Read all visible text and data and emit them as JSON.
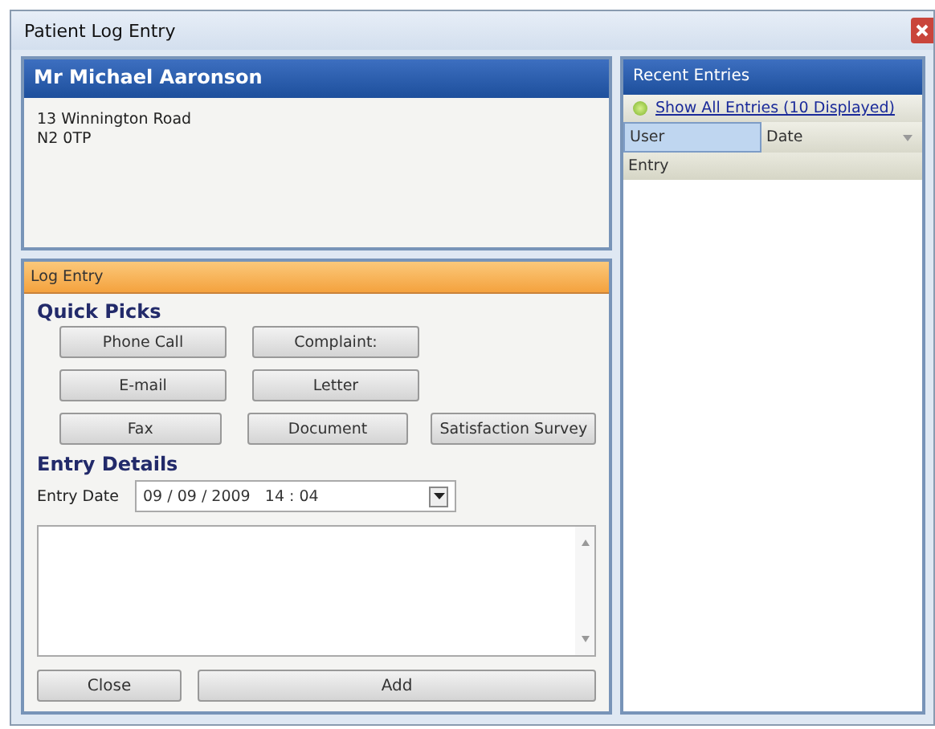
{
  "window": {
    "title": "Patient Log Entry"
  },
  "patient": {
    "name": "Mr Michael Aaronson",
    "address": [
      "13 Winnington Road",
      "N2 0TP"
    ]
  },
  "log_entry": {
    "title": "Log Entry",
    "quick_picks_title": "Quick Picks",
    "quick_picks": [
      [
        "Phone Call",
        "Complaint:"
      ],
      [
        "E-mail",
        "Letter"
      ],
      [
        "Fax",
        "Document",
        "Satisfaction Survey"
      ]
    ],
    "details_title": "Entry Details",
    "date_label": "Entry Date",
    "date_value": "09 / 09 / 2009   14 : 04",
    "buttons": [
      "Close",
      "Add"
    ]
  },
  "recent": {
    "title": "Recent Entries",
    "show_all": "Show All Entries (10 Displayed)",
    "columns": [
      {
        "label": "User",
        "selected": true
      },
      {
        "label": "Date",
        "selected": false
      }
    ],
    "second_row": "Entry"
  }
}
